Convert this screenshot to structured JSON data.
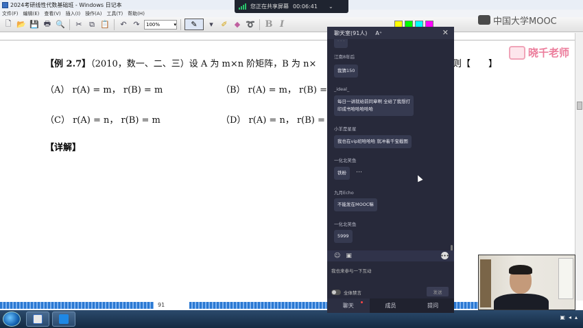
{
  "window": {
    "title": "2024考研线性代数基础班 - Windows 日记本"
  },
  "menu": [
    "文件(F)",
    "编辑(E)",
    "查看(V)",
    "插入(I)",
    "操作(A)",
    "工具(T)",
    "帮助(H)"
  ],
  "toolbar": {
    "zoom": "100%",
    "swatches": [
      "#ffff00",
      "#00ff00",
      "#00ffff",
      "#ff00ff",
      "#ff6600",
      "#000000",
      "#cc0000",
      "#009900",
      "#0000cc",
      "#9900cc",
      "#808080",
      "#ffffff"
    ]
  },
  "share_bar": {
    "text": "您正在共享屏幕",
    "timer": "00:06:41"
  },
  "brand": {
    "mooc": "中国大学MOOC",
    "teacher": "晓千老师"
  },
  "document": {
    "example_label": "【例 2.7】",
    "example_text": "（2010，数一、二、三）设 A 为 m×n 阶矩阵，B 为 n×",
    "tail": "则【　　】",
    "options": {
      "A": "（A） r(A) = m， r(B) = m",
      "B": "（B） r(A) = m， r(B) =",
      "C": "（C） r(A) = n， r(B) = m",
      "D": "（D） r(A) = n， r(B) ="
    },
    "detail": "【详解】",
    "page_number": "91"
  },
  "chat": {
    "title": "聊天室(91人)",
    "font_btn": "A⁺",
    "messages": [
      {
        "user": "江南8年后",
        "text": "我猜150"
      },
      {
        "user": "_ideal_",
        "text": "每日一讲就给前同章啊 全给了我想打\n印成书哈哈哈哈哈"
      },
      {
        "user": "小羊是星星",
        "text": "我也在vip班哈哈哈 就冲着千宝截图"
      },
      {
        "user": "一化北笑鱼",
        "text": "铁粉"
      },
      {
        "user": "九月Echo",
        "text": "不能发在MOOC嘛"
      },
      {
        "user": "一化北笑鱼",
        "text": "5999"
      }
    ],
    "input_placeholder": "我也来参与一下互动",
    "mute_label": "全体禁言",
    "send_label": "发送",
    "tabs": [
      "聊天",
      "成员",
      "提问"
    ]
  }
}
